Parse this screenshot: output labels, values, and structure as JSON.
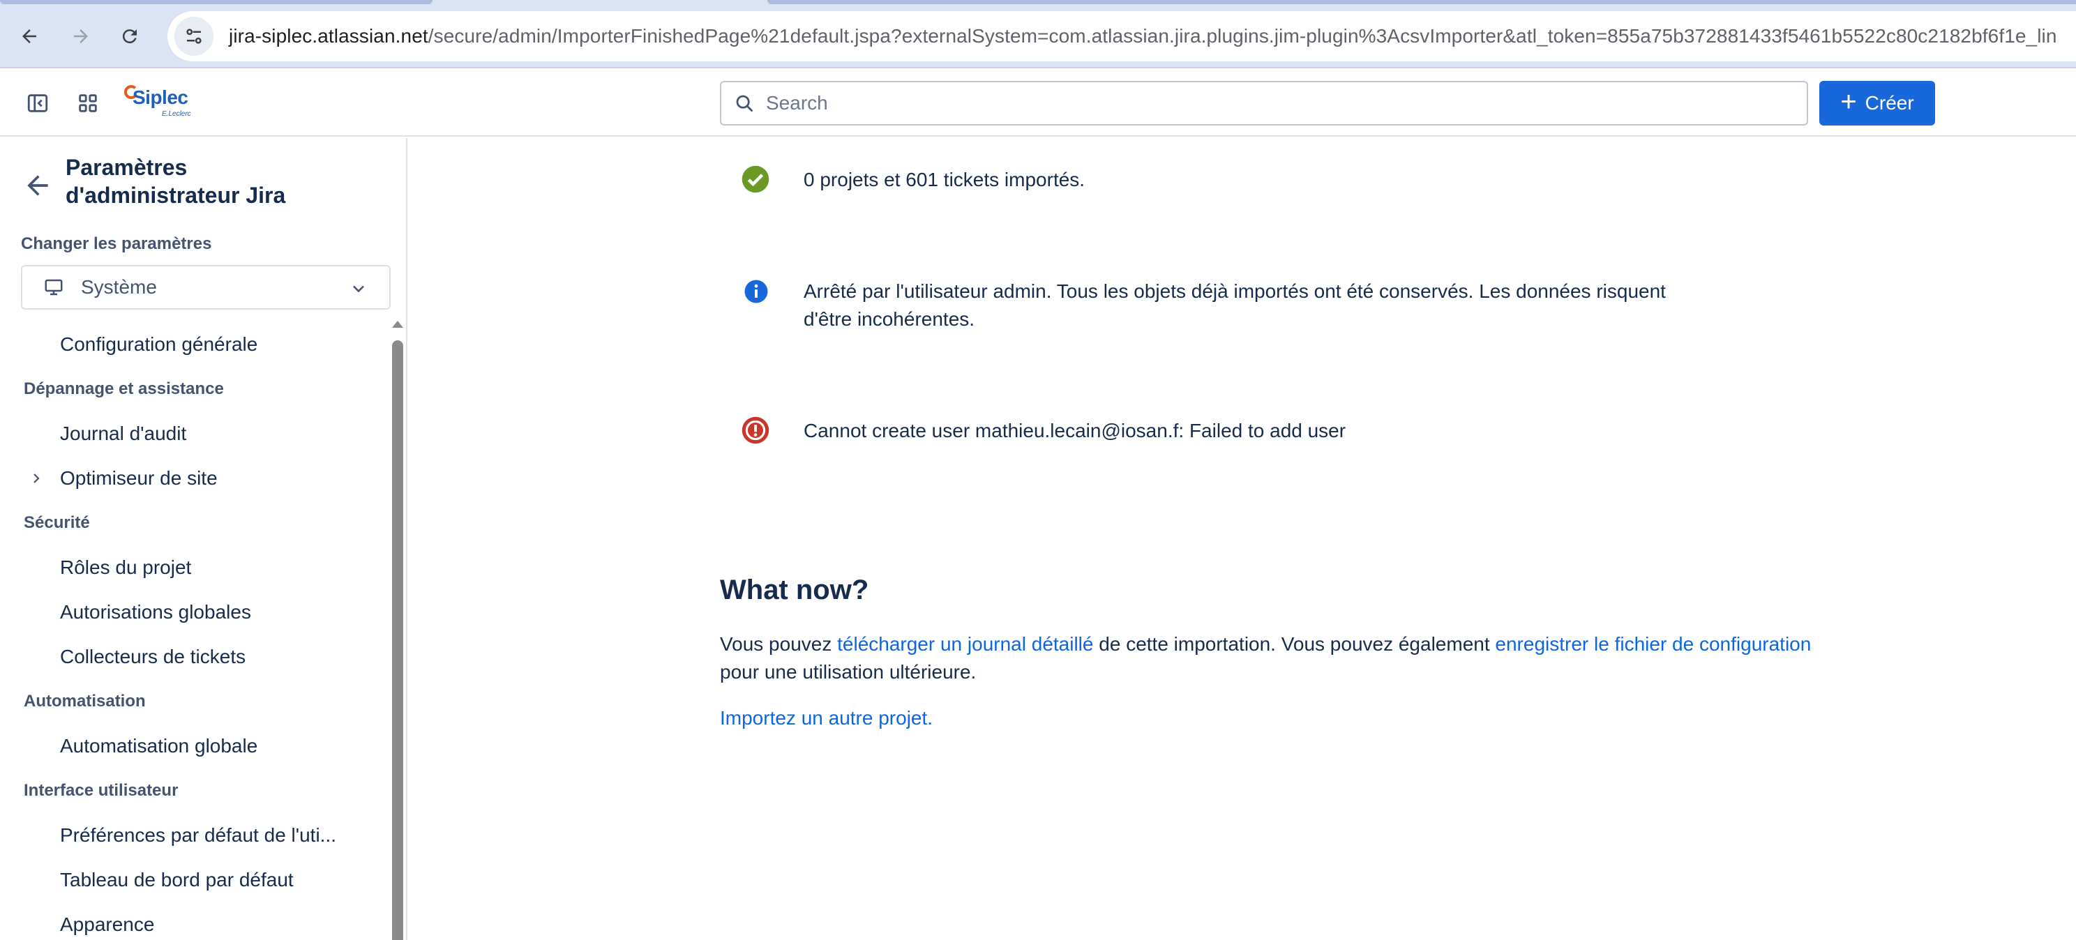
{
  "browser": {
    "url_host": "jira-siplec.atlassian.net",
    "url_path": "/secure/admin/ImporterFinishedPage%21default.jspa?externalSystem=com.atlassian.jira.plugins.jim-plugin%3AcsvImporter&atl_token=855a75b372881433f5461b5522c80c2182bf6f1e_lin"
  },
  "topbar": {
    "logo_text": "Siplec",
    "logo_tag": "E.Leclerc",
    "search_placeholder": "Search",
    "create_label": "Créer"
  },
  "sidebar": {
    "title": "Paramètres d'administrateur Jira",
    "caption": "Changer les paramètres",
    "select_value": "Système",
    "items": {
      "config_generale": "Configuration générale",
      "section_depannage": "Dépannage et assistance",
      "journal_audit": "Journal d'audit",
      "optimiseur": "Optimiseur de site",
      "section_securite": "Sécurité",
      "roles_projet": "Rôles du projet",
      "autorisations": "Autorisations globales",
      "collecteurs": "Collecteurs de tickets",
      "section_automatisation": "Automatisation",
      "automatisation_globale": "Automatisation globale",
      "section_interface": "Interface utilisateur",
      "preferences": "Préférences par défaut de l'uti...",
      "tableau_bord": "Tableau de bord par défaut",
      "apparence": "Apparence"
    }
  },
  "main": {
    "success_msg": "0 projets et 601 tickets importés.",
    "info_msg": "Arrêté par l'utilisateur admin. Tous les objets déjà importés ont été conservés. Les données risquent d'être incohérentes.",
    "error_msg": "Cannot create user mathieu.lecain@iosan.f: Failed to add user",
    "heading": "What now?",
    "para_1": "Vous pouvez ",
    "link_log": "télécharger un journal détaillé",
    "para_2": " de cette importation. Vous pouvez également ",
    "link_config": "enregistrer le fichier de configuration",
    "para_3": " pour une utilisation ultérieure.",
    "import_link": "Importez un autre projet."
  },
  "colors": {
    "primary": "#1868db",
    "success": "#6a9a23",
    "info": "#1868db",
    "error": "#c9372c",
    "link": "#0c66e4"
  }
}
